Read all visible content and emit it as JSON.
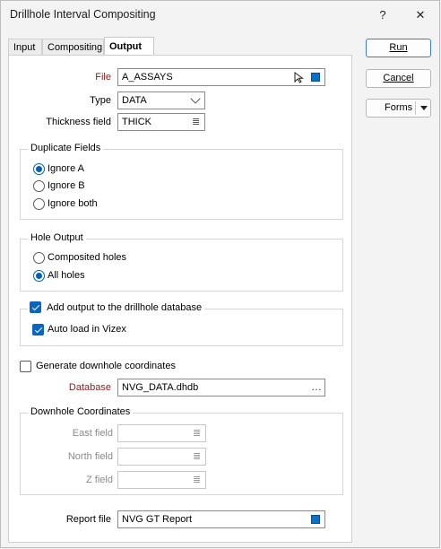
{
  "window": {
    "title": "Drillhole Interval Compositing",
    "help_label": "?",
    "close_label": "✕"
  },
  "tabs": [
    {
      "label": "Input"
    },
    {
      "label": "Compositing"
    },
    {
      "label": "Output"
    }
  ],
  "buttons": {
    "run": "Run",
    "cancel": "Cancel",
    "forms": "Forms"
  },
  "file": {
    "label": "File",
    "value": "A_ASSAYS"
  },
  "type": {
    "label": "Type",
    "value": "DATA"
  },
  "thickness": {
    "label": "Thickness field",
    "value": "THICK"
  },
  "duplicate_fields": {
    "title": "Duplicate Fields",
    "options": [
      "Ignore A",
      "Ignore B",
      "Ignore both"
    ],
    "selected": "Ignore A"
  },
  "hole_output": {
    "title": "Hole Output",
    "options": [
      "Composited holes",
      "All holes"
    ],
    "selected": "All holes"
  },
  "add_output": {
    "label": "Add output to the drillhole database",
    "checked": true
  },
  "auto_load": {
    "label": "Auto load in Vizex",
    "checked": true
  },
  "generate_coords": {
    "label": "Generate downhole coordinates",
    "checked": false
  },
  "database": {
    "label": "Database",
    "value": "NVG_DATA.dhdb"
  },
  "downhole_coords": {
    "title": "Downhole Coordinates",
    "east_label": "East field",
    "east_value": "",
    "north_label": "North field",
    "north_value": "",
    "z_label": "Z field",
    "z_value": ""
  },
  "report_file": {
    "label": "Report file",
    "value": "NVG GT Report"
  },
  "icons": {
    "list": "≣",
    "browse": "…",
    "accent": "#0a72c7"
  }
}
